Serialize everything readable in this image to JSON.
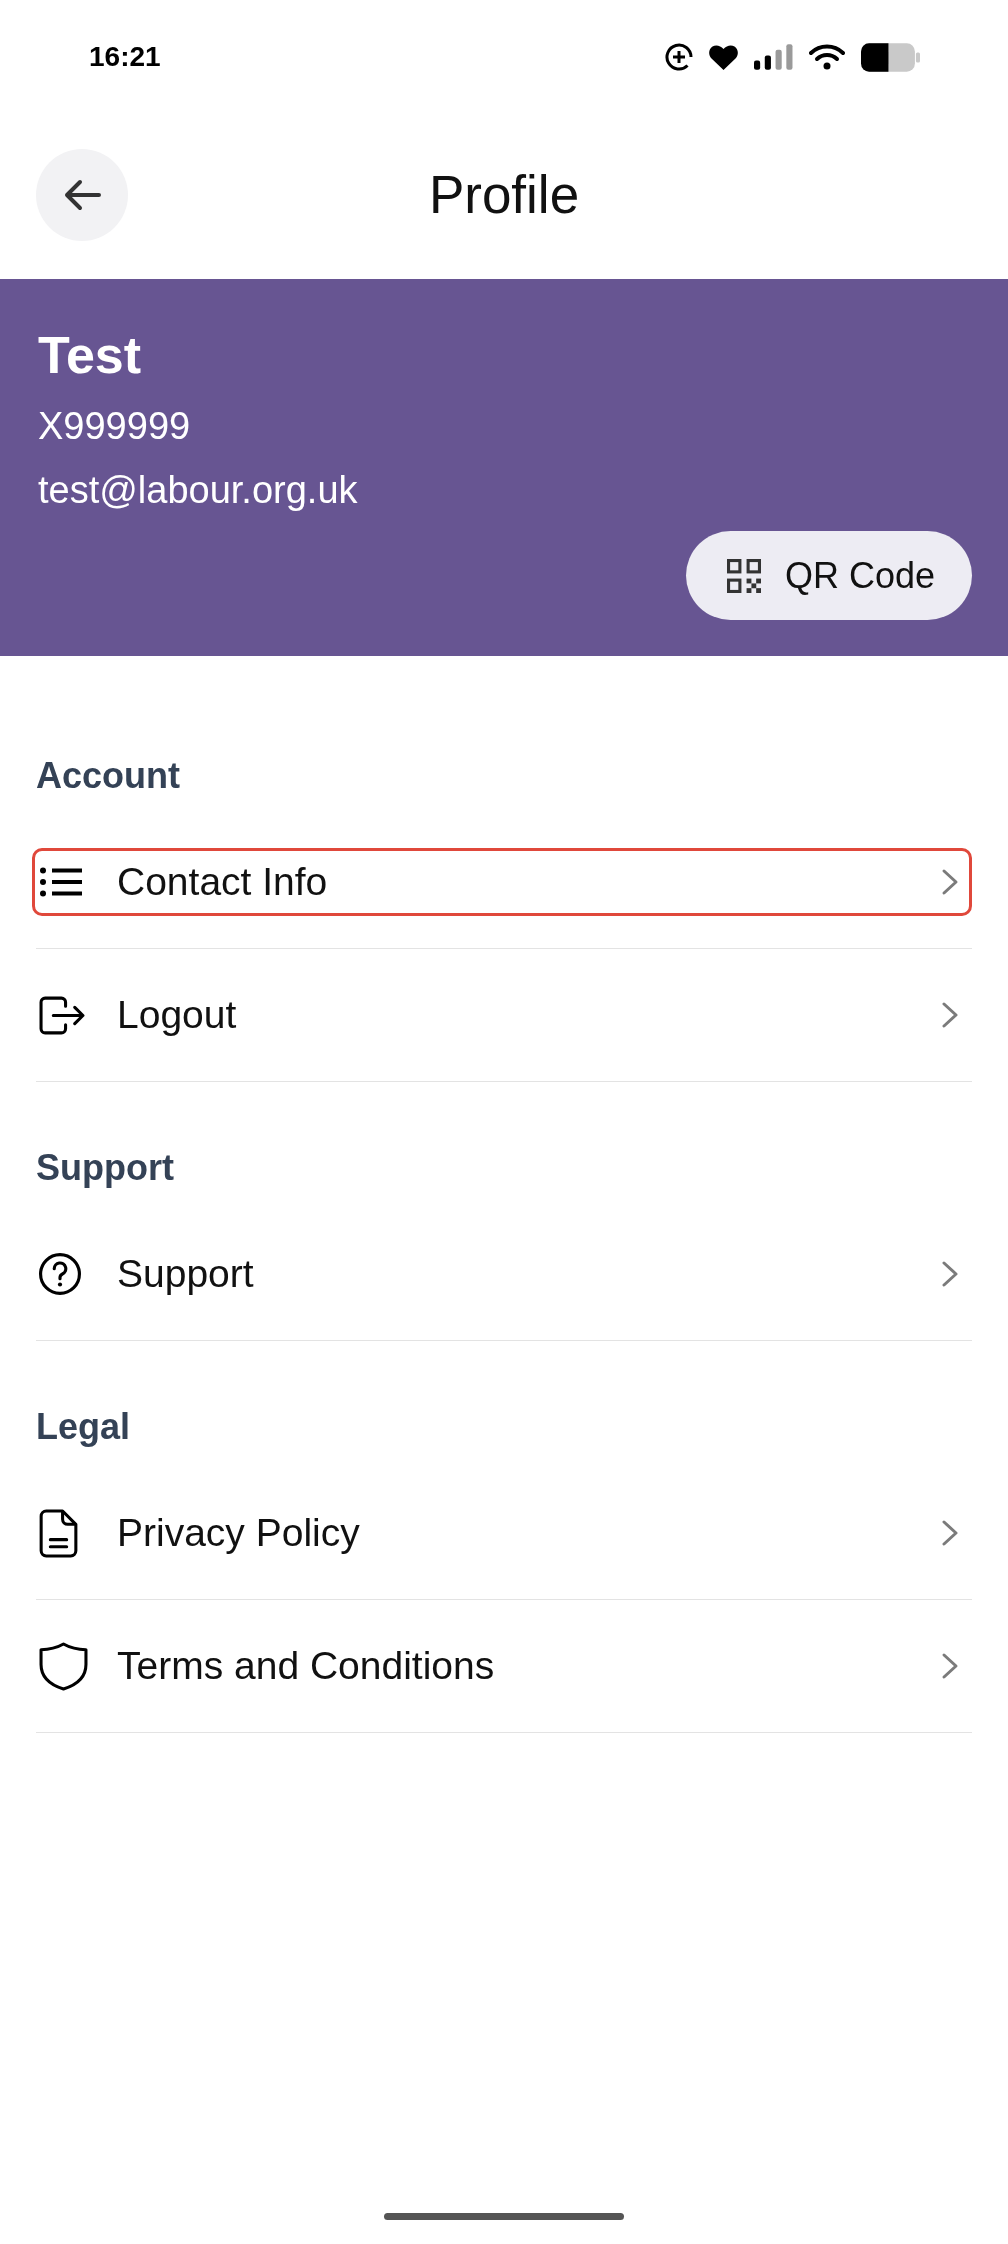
{
  "status_bar": {
    "time": "16:21"
  },
  "header": {
    "title": "Profile"
  },
  "profile": {
    "name": "Test",
    "member_id": "X999999",
    "email": "test@labour.org.uk",
    "qr_button": "QR Code"
  },
  "sections": [
    {
      "title": "Account",
      "items": [
        {
          "label": "Contact Info",
          "kind": "contact",
          "selected": true
        },
        {
          "label": "Logout",
          "kind": "logout",
          "selected": false
        }
      ]
    },
    {
      "title": "Support",
      "items": [
        {
          "label": "Support",
          "kind": "help",
          "selected": false
        }
      ]
    },
    {
      "title": "Legal",
      "items": [
        {
          "label": "Privacy Policy",
          "kind": "policy",
          "selected": false
        },
        {
          "label": "Terms and Conditions",
          "kind": "terms",
          "selected": false
        }
      ]
    }
  ]
}
